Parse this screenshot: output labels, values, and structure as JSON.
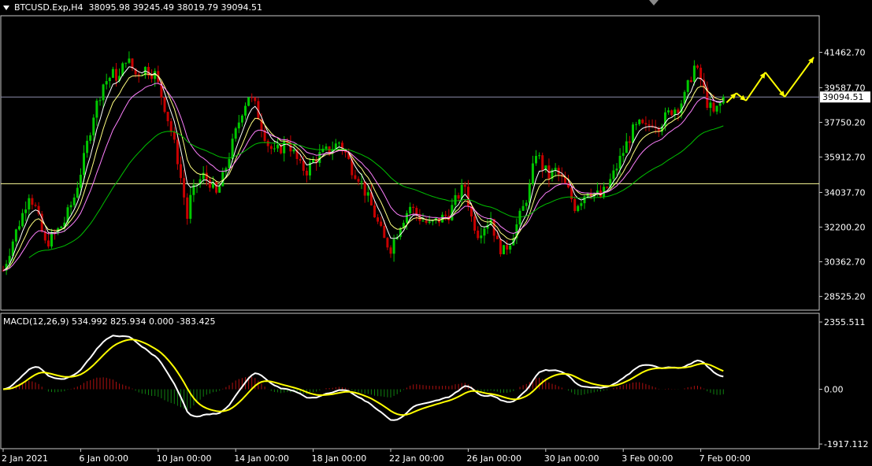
{
  "symbol_header": {
    "symbol": "BTCUSD.Exp,H4",
    "ohlc": "38095.98 39245.49 38019.79 39094.51"
  },
  "macd_header": {
    "label": "MACD(12,26,9) 534.992 825.934 0.000 -383.425"
  },
  "colors": {
    "background": "#000000",
    "grid_border": "#c8c8c8",
    "bull_candle": "#00c800",
    "bear_candle": "#c80000",
    "ma_fast": "#ffffff",
    "ma_mid": "#ffff80",
    "ma_slow": "#ff80ff",
    "ma_long": "#00c000",
    "arrow": "#ffff00",
    "macd_line": "#ffffff",
    "signal_line": "#ffff00",
    "hist_pos": "#b01010",
    "hist_neg": "#108010"
  },
  "chart_data": [
    {
      "type": "candlestick",
      "title": "BTCUSD.Exp,H4",
      "y_ticks": [
        "41462.70",
        "39587.70",
        "37750.20",
        "35912.70",
        "34037.70",
        "32200.20",
        "30362.70",
        "28525.20"
      ],
      "ylim": [
        27800,
        43400
      ],
      "current_price_label": "39094.51",
      "current_price": 39094.51,
      "support_level": 34500,
      "x_ticks": [
        "2 Jan 2021",
        "6 Jan 00:00",
        "10 Jan 00:00",
        "14 Jan 00:00",
        "18 Jan 00:00",
        "22 Jan 00:00",
        "26 Jan 00:00",
        "30 Jan 00:00",
        "3 Feb 00:00",
        "7 Feb 00:00"
      ],
      "x_tick_index": [
        0,
        24,
        48,
        72,
        96,
        120,
        144,
        168,
        192,
        216
      ],
      "keypoints": [
        [
          0,
          29900
        ],
        [
          3,
          31500
        ],
        [
          6,
          32900
        ],
        [
          8,
          34000
        ],
        [
          10,
          33200
        ],
        [
          13,
          31300
        ],
        [
          16,
          31800
        ],
        [
          19,
          32500
        ],
        [
          22,
          33800
        ],
        [
          25,
          35800
        ],
        [
          28,
          38200
        ],
        [
          31,
          39800
        ],
        [
          34,
          40300
        ],
        [
          36,
          40100
        ],
        [
          38,
          41200
        ],
        [
          41,
          40300
        ],
        [
          44,
          40600
        ],
        [
          47,
          40300
        ],
        [
          50,
          38600
        ],
        [
          52,
          37300
        ],
        [
          54,
          35800
        ],
        [
          56,
          33800
        ],
        [
          57,
          32700
        ],
        [
          58,
          33700
        ],
        [
          60,
          34500
        ],
        [
          62,
          34900
        ],
        [
          64,
          34600
        ],
        [
          66,
          33900
        ],
        [
          68,
          34800
        ],
        [
          70,
          36000
        ],
        [
          72,
          37200
        ],
        [
          74,
          38400
        ],
        [
          76,
          39200
        ],
        [
          78,
          38600
        ],
        [
          80,
          37600
        ],
        [
          82,
          36600
        ],
        [
          84,
          36100
        ],
        [
          86,
          36400
        ],
        [
          88,
          36800
        ],
        [
          90,
          36100
        ],
        [
          92,
          35400
        ],
        [
          94,
          35200
        ],
        [
          96,
          35700
        ],
        [
          98,
          36000
        ],
        [
          100,
          36200
        ],
        [
          102,
          36400
        ],
        [
          104,
          36700
        ],
        [
          106,
          36100
        ],
        [
          108,
          35300
        ],
        [
          110,
          34900
        ],
        [
          112,
          34100
        ],
        [
          114,
          33300
        ],
        [
          116,
          32400
        ],
        [
          118,
          31500
        ],
        [
          120,
          31100
        ],
        [
          123,
          32400
        ],
        [
          126,
          33300
        ],
        [
          129,
          32700
        ],
        [
          132,
          32300
        ],
        [
          135,
          32600
        ],
        [
          138,
          32900
        ],
        [
          141,
          33900
        ],
        [
          143,
          34400
        ],
        [
          145,
          32700
        ],
        [
          147,
          31900
        ],
        [
          149,
          32300
        ],
        [
          151,
          32700
        ],
        [
          153,
          31300
        ],
        [
          155,
          30900
        ],
        [
          157,
          31500
        ],
        [
          159,
          32300
        ],
        [
          161,
          33200
        ],
        [
          163,
          34300
        ],
        [
          165,
          36200
        ],
        [
          167,
          35400
        ],
        [
          169,
          34900
        ],
        [
          171,
          35200
        ],
        [
          173,
          34700
        ],
        [
          175,
          34100
        ],
        [
          177,
          33300
        ],
        [
          179,
          33700
        ],
        [
          181,
          34200
        ],
        [
          183,
          34000
        ],
        [
          185,
          33800
        ],
        [
          187,
          34300
        ],
        [
          189,
          35000
        ],
        [
          191,
          35800
        ],
        [
          193,
          36600
        ],
        [
          195,
          37300
        ],
        [
          197,
          37600
        ],
        [
          199,
          37400
        ],
        [
          201,
          37800
        ],
        [
          203,
          37600
        ],
        [
          205,
          38000
        ],
        [
          207,
          38400
        ],
        [
          209,
          38600
        ],
        [
          211,
          39100
        ],
        [
          213,
          40200
        ],
        [
          214,
          40700
        ],
        [
          216,
          40000
        ],
        [
          218,
          38800
        ],
        [
          220,
          38200
        ],
        [
          222,
          38700
        ],
        [
          223,
          39094.51
        ]
      ],
      "forecast_path": [
        [
          224,
          38800
        ],
        [
          227,
          39300
        ],
        [
          230,
          38900
        ],
        [
          236,
          40400
        ],
        [
          242,
          39100
        ],
        [
          251,
          41200
        ]
      ],
      "indicators": [
        "fast MA",
        "medium MA",
        "slow MA",
        "long MA"
      ]
    },
    {
      "type": "macd",
      "title": "MACD(12,26,9) 534.992 825.934 0.000 -383.425",
      "y_ticks": [
        "2355.511",
        "0.00",
        "-1917.112"
      ],
      "ylim": [
        -2080,
        2660
      ],
      "macd": 534.992,
      "signal": 825.934,
      "histogram": -383.425
    }
  ]
}
